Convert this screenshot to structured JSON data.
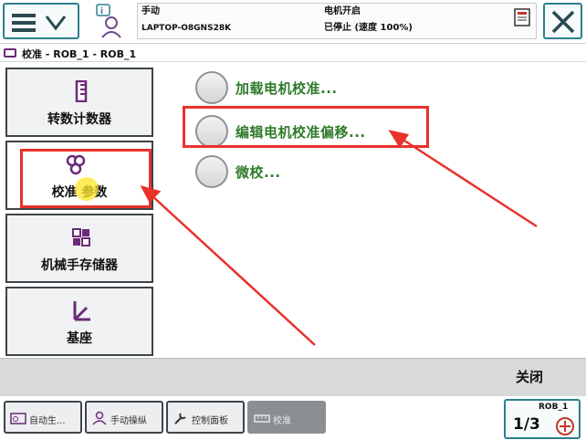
{
  "status_bar": {
    "mode": "手动",
    "controller": "LAPTOP-O8GNS28K",
    "motor_state": "电机开启",
    "run_state": "已停止 (速度 100%)"
  },
  "title": {
    "breadcrumb": "校准 - ROB_1 - ROB_1"
  },
  "sidebar": {
    "items": [
      {
        "label": "转数计数器",
        "icon": "revolution-counter-icon"
      },
      {
        "label": "校准 参数",
        "icon": "calibration-params-icon"
      },
      {
        "label": "机械手存储器",
        "icon": "smb-memory-icon"
      },
      {
        "label": "基座",
        "icon": "base-frame-icon"
      }
    ]
  },
  "options": [
    {
      "label": "加载电机校准..."
    },
    {
      "label": "编辑电机校准偏移..."
    },
    {
      "label": "微校..."
    }
  ],
  "bottom": {
    "close_label": "关闭"
  },
  "taskbar": {
    "items": [
      {
        "label": "自动生...",
        "icon": "auto-production-icon"
      },
      {
        "label": "手动操纵",
        "icon": "jogging-icon"
      },
      {
        "label": "控制面板",
        "icon": "control-panel-icon"
      },
      {
        "label": "校准",
        "icon": "calibration-icon"
      }
    ],
    "quickset": {
      "robot": "ROB_1",
      "fraction": "1/3"
    }
  },
  "colors": {
    "accent": "#2c7f8f",
    "option_text": "#2e7b2a",
    "annotation_red": "#e8322b"
  }
}
